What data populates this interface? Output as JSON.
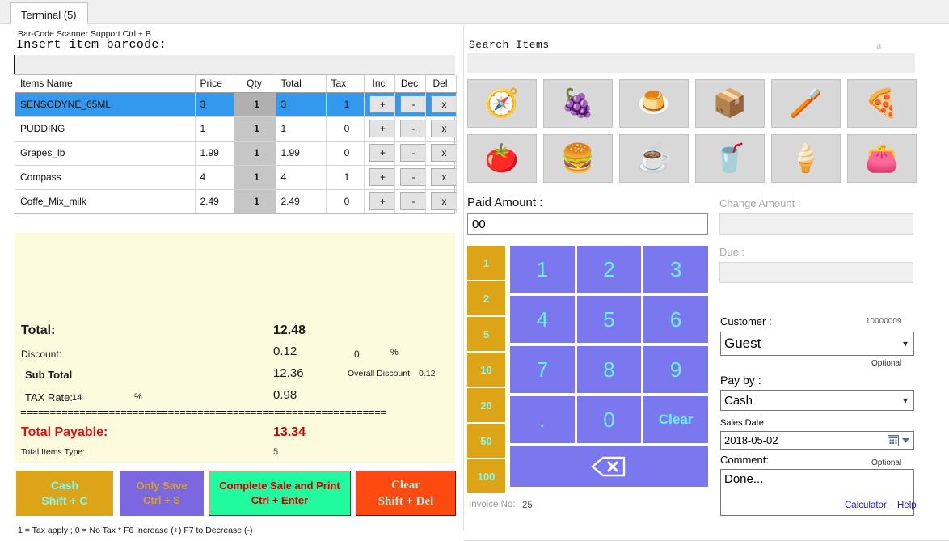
{
  "window": {
    "tab_label": "Terminal (5)"
  },
  "left": {
    "barcode_hint": "Bar-Code Scanner Support Ctrl + B",
    "barcode_label": "Insert item barcode:",
    "barcode_value": "",
    "columns": [
      "Items Name",
      "Price",
      "Qty",
      "Total",
      "Tax",
      "Inc",
      "Dec",
      "Del"
    ],
    "rows": [
      {
        "name": "SENSODYNE_65ML",
        "price": "3",
        "qty": "1",
        "total": "3",
        "tax": "1",
        "inc": "+",
        "dec": "-",
        "del": "x",
        "selected": true
      },
      {
        "name": "PUDDING",
        "price": "1",
        "qty": "1",
        "total": "1",
        "tax": "0",
        "inc": "+",
        "dec": "-",
        "del": "x",
        "selected": false
      },
      {
        "name": "Grapes_lb",
        "price": "1.99",
        "qty": "1",
        "total": "1.99",
        "tax": "0",
        "inc": "+",
        "dec": "-",
        "del": "x",
        "selected": false
      },
      {
        "name": "Compass",
        "price": "4",
        "qty": "1",
        "total": "4",
        "tax": "1",
        "inc": "+",
        "dec": "-",
        "del": "x",
        "selected": false
      },
      {
        "name": "Coffe_Mix_milk",
        "price": "2.49",
        "qty": "1",
        "total": "2.49",
        "tax": "0",
        "inc": "+",
        "dec": "-",
        "del": "x",
        "selected": false
      }
    ],
    "totals": {
      "total_label": "Total:",
      "total_value": "12.48",
      "discount_label": "Discount:",
      "discount_value": "0.12",
      "discount_pct": "0",
      "pct_symbol": "%",
      "subtotal_label": "Sub Total",
      "subtotal_value": "12.36",
      "overall_discount_label": "Overall Discount:",
      "overall_discount_value": "0.12",
      "tax_rate_label": "TAX Rate:",
      "tax_rate_value": "14",
      "tax_value": "0.98",
      "separator": "==============================================================",
      "payable_label": "Total Payable:",
      "payable_value": "13.34",
      "items_type_label": "Total Items Type:",
      "items_type_value": "5"
    },
    "actions": {
      "cash_line1": "Cash",
      "cash_line2": "Shift + C",
      "save_line1": "Only Save",
      "save_line2": "Ctrl + S",
      "complete_line1": "Complete Sale and Print",
      "complete_line2": "Ctrl + Enter",
      "clear_line1": "Clear",
      "clear_line2": "Shift + Del"
    },
    "footnote": "1 = Tax apply ; 0 =  No Tax  * F6 Increase (+)  F7 to Decrease (-)"
  },
  "right": {
    "search_label": "Search Items",
    "search_hint": "a",
    "search_value": "",
    "tiles": [
      {
        "icon": "compass-icon",
        "glyph": "🧭"
      },
      {
        "icon": "grapes-icon",
        "glyph": "🍇"
      },
      {
        "icon": "pudding-icon",
        "glyph": "🍮"
      },
      {
        "icon": "package-icon",
        "glyph": "📦"
      },
      {
        "icon": "toothpaste-icon",
        "glyph": "🪥"
      },
      {
        "icon": "pizza-icon",
        "glyph": "🍕"
      },
      {
        "icon": "tomato-icon",
        "glyph": "🍅"
      },
      {
        "icon": "burger-icon",
        "glyph": "🍔"
      },
      {
        "icon": "coffee-cup-icon",
        "glyph": "☕"
      },
      {
        "icon": "cola-bottle-icon",
        "glyph": "🥤"
      },
      {
        "icon": "ice-cream-icon",
        "glyph": "🍦"
      },
      {
        "icon": "wallet-icon",
        "glyph": "👛"
      }
    ],
    "paid_label": "Paid Amount :",
    "paid_value": "00",
    "change_label": "Change Amount :",
    "change_value": "",
    "due_label": "Due :",
    "due_value": "",
    "denominations": [
      "1",
      "2",
      "5",
      "10",
      "20",
      "50",
      "100"
    ],
    "keypad": [
      "1",
      "2",
      "3",
      "4",
      "5",
      "6",
      "7",
      "8",
      "9",
      ".",
      "0",
      "Clear"
    ],
    "backspace_label": "backspace-icon",
    "customer_label": "Customer :",
    "customer_id": "10000009",
    "customer_value": "Guest",
    "customer_optional": "Optional",
    "payby_label": "Pay by :",
    "payby_value": "Cash",
    "date_label": "Sales Date",
    "date_value": "2018-05-02",
    "comment_label": "Comment:",
    "comment_optional": "Optional",
    "comment_value": "Done...",
    "invoice_label": "Invoice No:",
    "invoice_no": "25",
    "calculator_link": "Calculator",
    "help_link": "Help"
  },
  "colors": {
    "selected_row": "#3399ee",
    "gold": "#dda418",
    "purple": "#7b77ef",
    "green": "#1ffb9e",
    "red_orange": "#fc4a11",
    "payable_red": "#c40000",
    "totals_bg": "#fdfbdd"
  }
}
